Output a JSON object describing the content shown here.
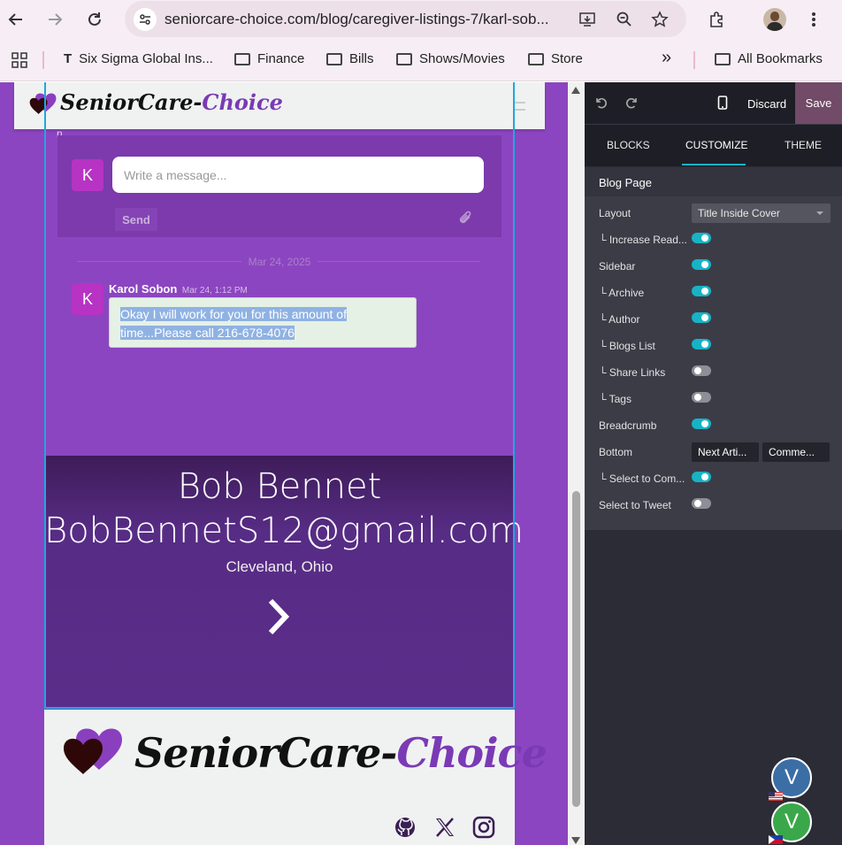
{
  "browser": {
    "url": "seniorcare-choice.com/blog/caregiver-listings-7/karl-sob...",
    "bookmarks": [
      "Six Sigma Global Ins...",
      "Finance",
      "Bills",
      "Shows/Movies",
      "Store"
    ],
    "all_bookmarks": "All Bookmarks",
    "overflow": "»"
  },
  "site": {
    "logo_text_a": "SeniorCare-",
    "logo_text_b": "Choice",
    "fragment": "n"
  },
  "chat": {
    "avatar_letter": "K",
    "placeholder": "Write a message...",
    "send_label": "Send",
    "date": "Mar 24, 2025",
    "author": "Karol Sobon",
    "time": "Mar 24, 1:12 PM",
    "message_line1": "Okay I will work for you for this amount of",
    "message_line2": "time...Please call 216-678-4076"
  },
  "cover": {
    "title_line1": "Bob Bennet",
    "title_line2": "BobBennetS12@gmail.com",
    "subtitle": "Cleveland, Ohio"
  },
  "editor": {
    "discard": "Discard",
    "save": "Save",
    "tabs": [
      "BLOCKS",
      "CUSTOMIZE",
      "THEME"
    ],
    "section": "Blog Page",
    "layout_label": "Layout",
    "layout_value": "Title Inside Cover",
    "bottom_label": "Bottom",
    "bottom_opt1": "Next Arti...",
    "bottom_opt2": "Comme...",
    "rows": [
      {
        "label": "└ Increase Read...",
        "on": true
      },
      {
        "label": "Sidebar",
        "on": true
      },
      {
        "label": "└ Archive",
        "on": true
      },
      {
        "label": "└ Author",
        "on": true
      },
      {
        "label": "└ Blogs List",
        "on": true
      },
      {
        "label": "└ Share Links",
        "on": false
      },
      {
        "label": "└ Tags",
        "on": false
      },
      {
        "label": "Breadcrumb",
        "on": true
      },
      {
        "label": "└ Select to Com...",
        "on": true
      },
      {
        "label": "Select to Tweet",
        "on": false
      }
    ]
  },
  "fabs": {
    "letter1": "V",
    "letter2": "V",
    "color1": "#3b6ea5",
    "color2": "#3aa84a"
  },
  "colors": {
    "brand_purple": "#8c45c0",
    "accent_teal": "#17b3c5",
    "save_bg": "#714b67"
  }
}
